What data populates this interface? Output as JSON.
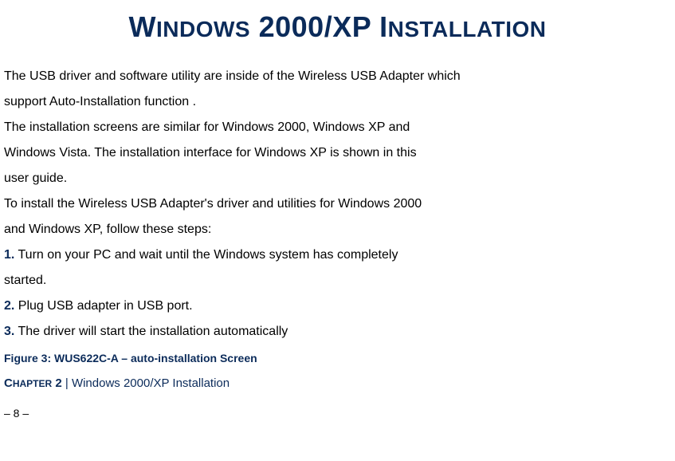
{
  "title": {
    "word1_first": "W",
    "word1_rest": "INDOWS",
    "middle": " 2000/XP ",
    "word2_first": "I",
    "word2_rest": "NSTALLATION"
  },
  "para1a": "The USB driver and software utility are inside of the Wireless USB Adapter which",
  "para1b": "support Auto-Installation function .",
  "para2a": "The installation screens are similar for Windows 2000, Windows XP and",
  "para2b": "Windows Vista. The installation interface for Windows XP is shown in this",
  "para2c": "user guide.",
  "para3a": "To install the Wireless USB Adapter's driver and utilities for Windows 2000",
  "para3b": "and Windows XP, follow these steps:",
  "steps": {
    "n1": "1.",
    "t1a": " Turn on your PC and wait until the Windows system has completely",
    "t1b": "started.",
    "n2": "2.",
    "t2": " Plug USB adapter in USB port.",
    "n3": "3.",
    "t3": " The driver will start the installation automatically"
  },
  "figure": "Figure 3: WUS622C-A – auto-installation Screen",
  "chapter": {
    "label_first": "C",
    "label_rest": "HAPTER",
    "num": " 2",
    "sep": " | ",
    "text": "Windows 2000/XP Installation"
  },
  "pagenum": "– 8 –"
}
